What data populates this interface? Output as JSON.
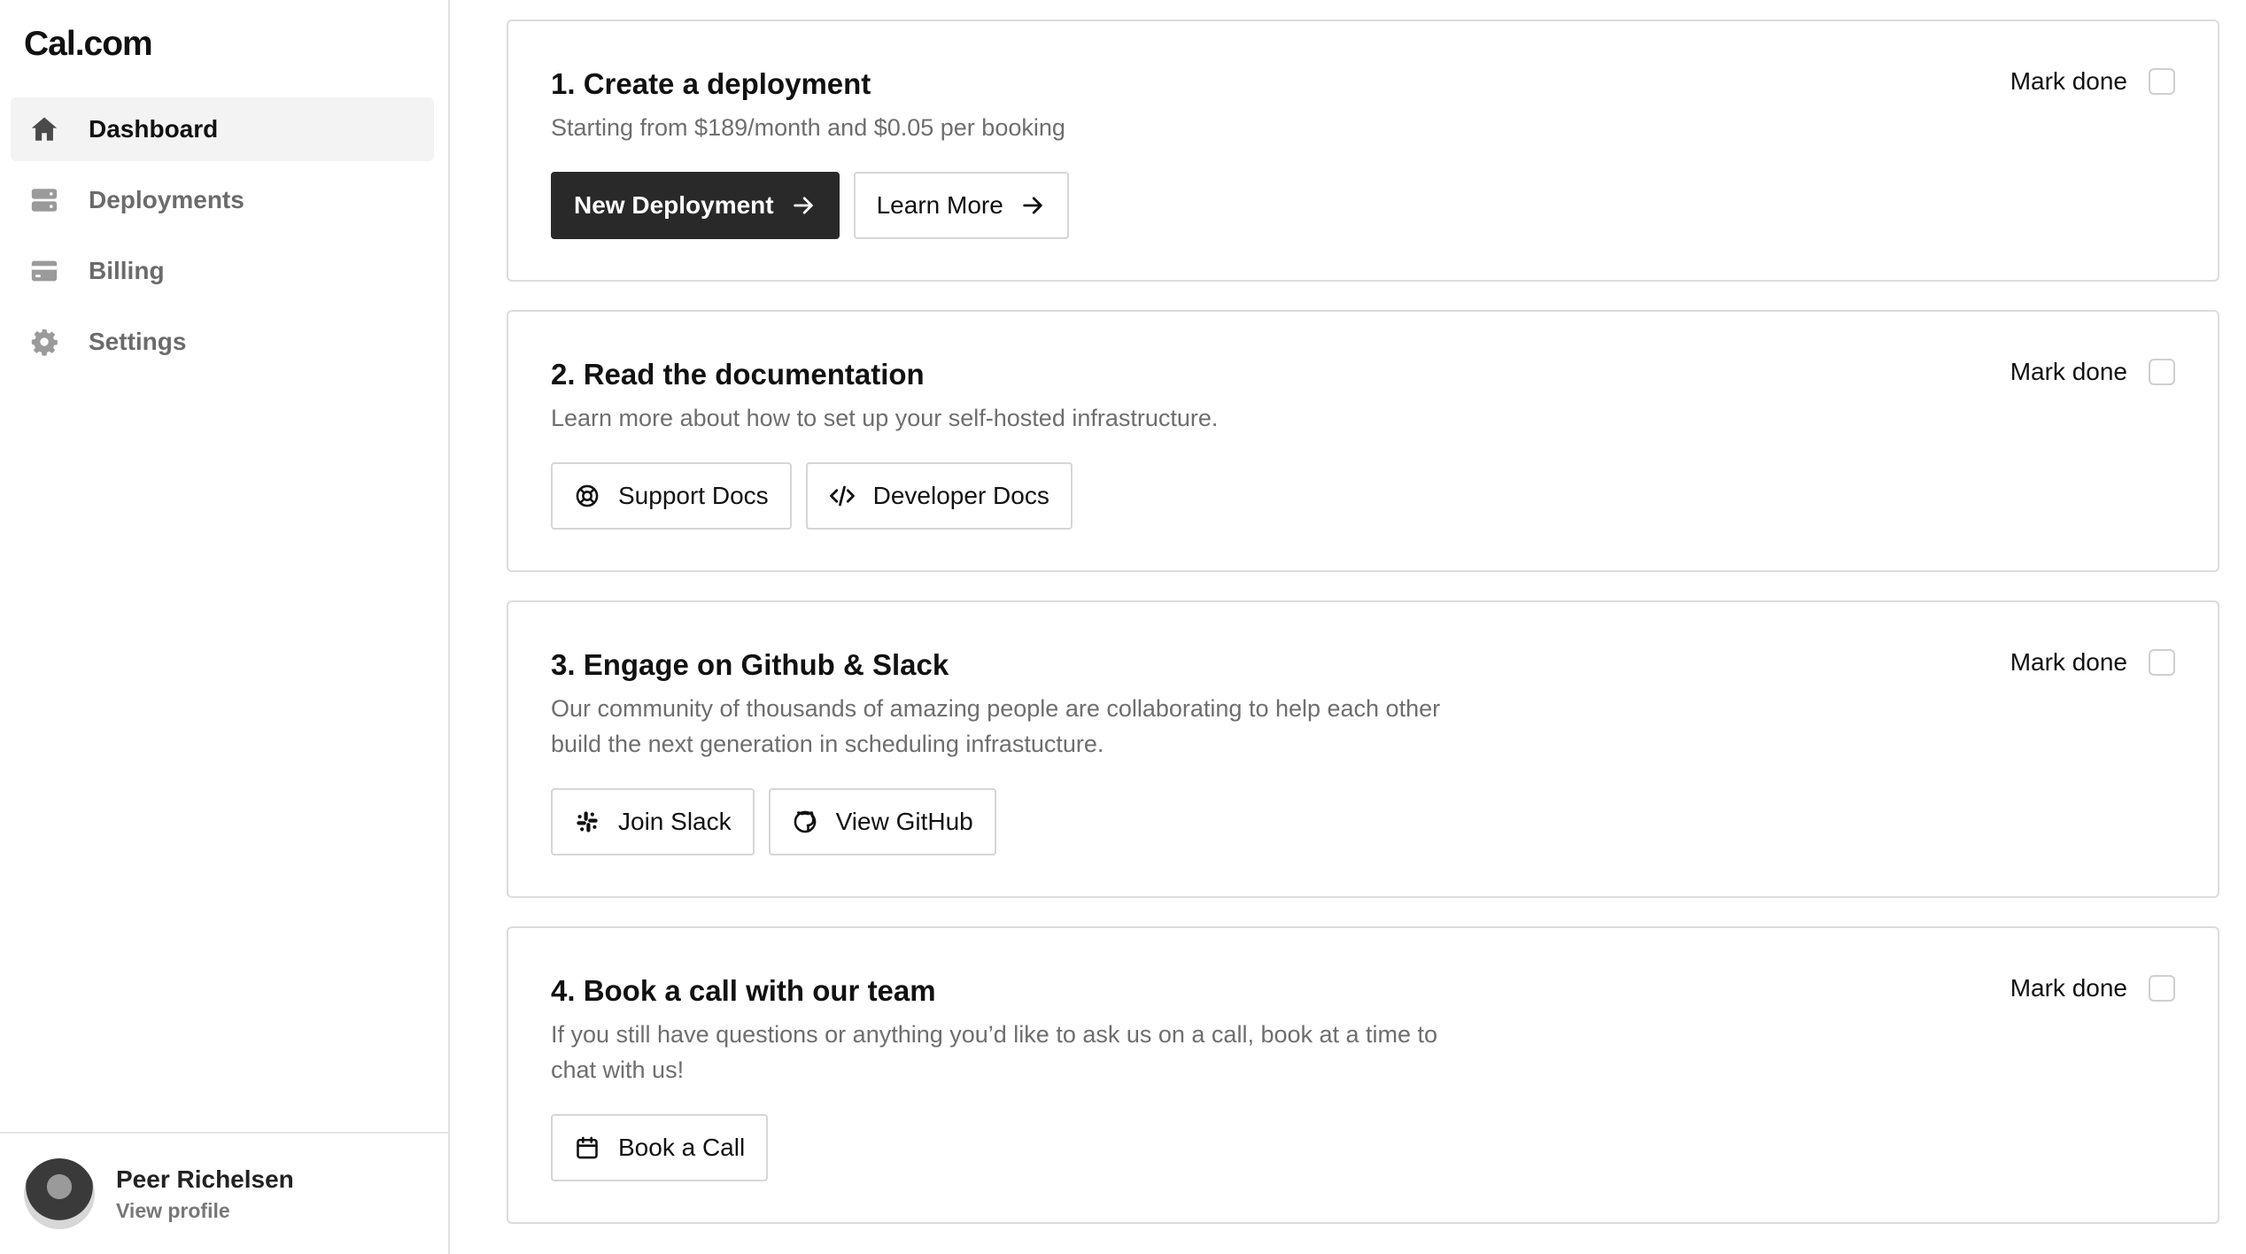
{
  "app": {
    "logo": "Cal.com"
  },
  "sidebar": {
    "items": [
      {
        "label": "Dashboard",
        "icon": "home-icon",
        "active": true
      },
      {
        "label": "Deployments",
        "icon": "server-icon",
        "active": false
      },
      {
        "label": "Billing",
        "icon": "credit-card-icon",
        "active": false
      },
      {
        "label": "Settings",
        "icon": "gear-icon",
        "active": false
      }
    ]
  },
  "profile": {
    "name": "Peer Richelsen",
    "link": "View profile"
  },
  "cards": [
    {
      "title": "1. Create a deployment",
      "description": "Starting from $189/month and $0.05 per booking",
      "mark_done": "Mark done",
      "buttons": [
        {
          "label": "New Deployment",
          "icon": "arrow-right-icon"
        },
        {
          "label": "Learn More",
          "icon": "arrow-right-icon"
        }
      ]
    },
    {
      "title": "2. Read the documentation",
      "description": "Learn more about how to set up your self-hosted infrastructure.",
      "mark_done": "Mark done",
      "buttons": [
        {
          "label": "Support Docs",
          "icon": "lifebuoy-icon"
        },
        {
          "label": "Developer Docs",
          "icon": "code-icon"
        }
      ]
    },
    {
      "title": "3. Engage on Github & Slack",
      "description": "Our community of thousands of amazing people are collaborating to help each other build the next generation in scheduling infrastucture.",
      "mark_done": "Mark done",
      "buttons": [
        {
          "label": "Join Slack",
          "icon": "slack-icon"
        },
        {
          "label": "View GitHub",
          "icon": "github-icon"
        }
      ]
    },
    {
      "title": "4. Book a call with our team",
      "description": "If you still have questions or anything you’d like to ask us on a call, book at a time to chat with us!",
      "mark_done": "Mark done",
      "buttons": [
        {
          "label": "Book a Call",
          "icon": "calendar-icon"
        }
      ]
    }
  ]
}
